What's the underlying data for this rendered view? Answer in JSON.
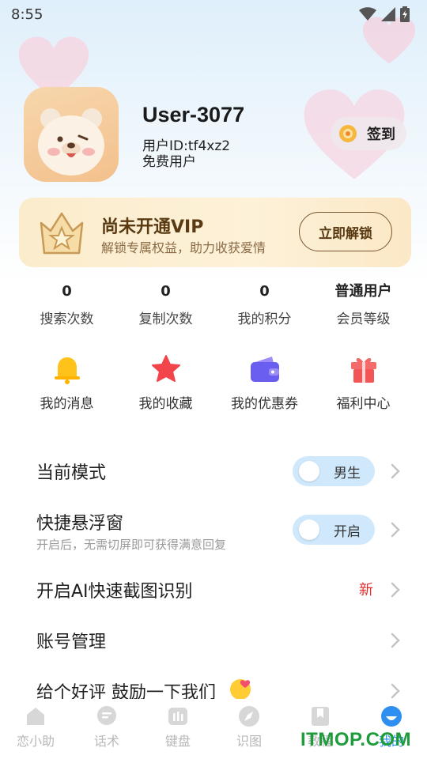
{
  "status_bar": {
    "time": "8:55"
  },
  "profile": {
    "username": "User-3077",
    "user_id": "用户ID:tf4xz2",
    "user_type": "免费用户",
    "checkin_label": "签到"
  },
  "vip": {
    "title": "尚未开通VIP",
    "subtitle": "解锁专属权益，助力收获爱情",
    "button": "立即解锁"
  },
  "stats": [
    {
      "value": "0",
      "label": "搜索次数"
    },
    {
      "value": "0",
      "label": "复制次数"
    },
    {
      "value": "0",
      "label": "我的积分"
    },
    {
      "value": "普通用户",
      "label": "会员等级"
    }
  ],
  "shortcuts": [
    {
      "label": "我的消息",
      "icon": "bell-icon"
    },
    {
      "label": "我的收藏",
      "icon": "star-icon"
    },
    {
      "label": "我的优惠券",
      "icon": "wallet-icon"
    },
    {
      "label": "福利中心",
      "icon": "gift-icon"
    }
  ],
  "settings": {
    "mode": {
      "label": "当前模式",
      "toggle": "男生"
    },
    "float": {
      "label": "快捷悬浮窗",
      "sub": "开启后，无需切屏即可获得满意回复",
      "toggle": "开启"
    },
    "ai": {
      "label": "开启AI快速截图识别",
      "badge": "新"
    },
    "account": {
      "label": "账号管理"
    },
    "review": {
      "label": "给个好评 鼓励一下我们"
    }
  },
  "tabs": [
    {
      "label": "恋小助",
      "icon": "house-icon"
    },
    {
      "label": "话术",
      "icon": "chat-icon"
    },
    {
      "label": "键盘",
      "icon": "keyboard-icon"
    },
    {
      "label": "识图",
      "icon": "compass-icon"
    },
    {
      "label": "教程",
      "icon": "bookmark-icon"
    },
    {
      "label": "我的",
      "icon": "profile-icon"
    }
  ],
  "watermark": "ITMOP.COM",
  "colors": {
    "accent": "#2f8ff0",
    "vip_text": "#5a3a12",
    "new_badge": "#e02b2b",
    "toggle_bg": "#cfe8fb"
  }
}
